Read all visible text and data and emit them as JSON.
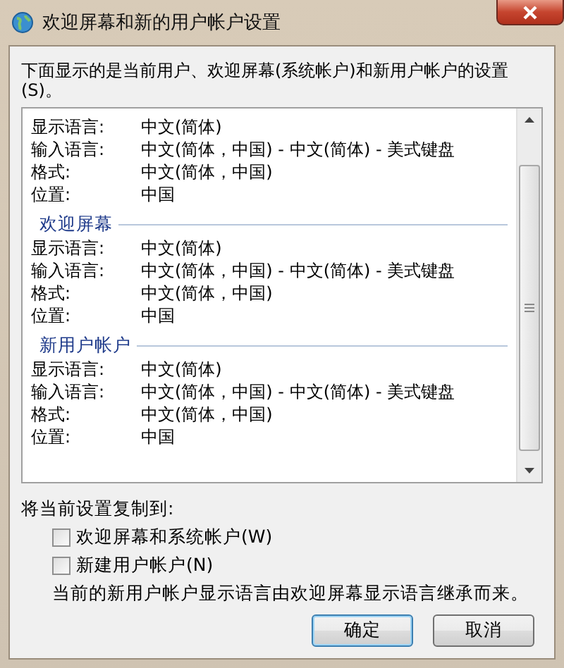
{
  "window": {
    "title": "欢迎屏幕和新的用户帐户设置"
  },
  "intro": "下面显示的是当前用户、欢迎屏幕(系统帐户)和新用户帐户的设置(S)。",
  "sections": [
    {
      "rows": [
        {
          "label": "显示语言:",
          "value": "中文(简体)"
        },
        {
          "label": "输入语言:",
          "value": "中文(简体，中国) - 中文(简体) - 美式键盘"
        },
        {
          "label": "格式:",
          "value": "中文(简体，中国)"
        },
        {
          "label": "位置:",
          "value": "中国"
        }
      ]
    },
    {
      "heading": "欢迎屏幕",
      "rows": [
        {
          "label": "显示语言:",
          "value": "中文(简体)"
        },
        {
          "label": "输入语言:",
          "value": "中文(简体，中国) - 中文(简体) - 美式键盘"
        },
        {
          "label": "格式:",
          "value": "中文(简体，中国)"
        },
        {
          "label": "位置:",
          "value": "中国"
        }
      ]
    },
    {
      "heading": "新用户帐户",
      "rows": [
        {
          "label": "显示语言:",
          "value": "中文(简体)"
        },
        {
          "label": "输入语言:",
          "value": "中文(简体，中国) - 中文(简体) - 美式键盘"
        },
        {
          "label": "格式:",
          "value": "中文(简体，中国)"
        },
        {
          "label": "位置:",
          "value": "中国"
        }
      ]
    }
  ],
  "copy_label": "将当前设置复制到:",
  "checkboxes": [
    {
      "label": "欢迎屏幕和系统帐户(W)",
      "checked": false
    },
    {
      "label": "新建用户帐户(N)",
      "checked": false
    }
  ],
  "note": "当前的新用户帐户显示语言由欢迎屏幕显示语言继承而来。",
  "buttons": [
    {
      "label": "确定",
      "default": true
    },
    {
      "label": "取消",
      "default": false
    }
  ]
}
